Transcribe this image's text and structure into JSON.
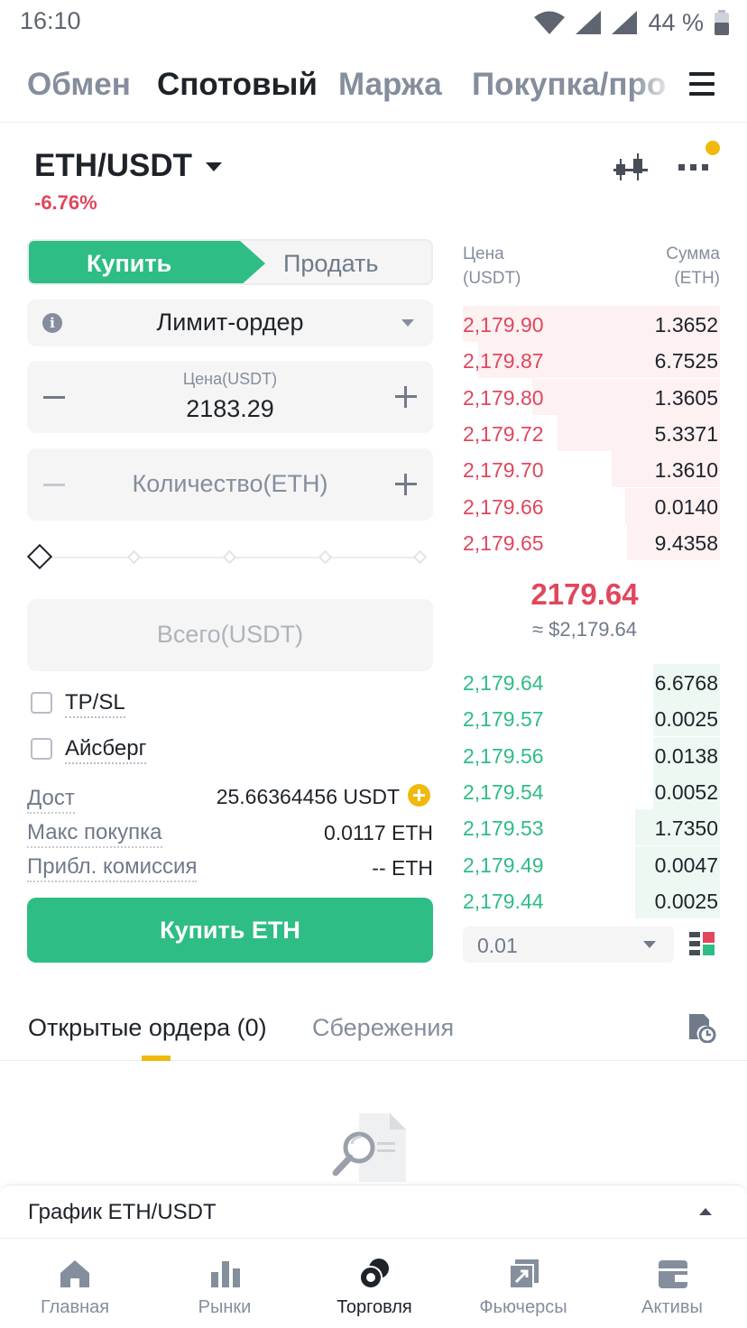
{
  "status_bar": {
    "time": "16:10",
    "battery": "44 %"
  },
  "top_tabs": [
    "Обмен",
    "Спотовый",
    "Маржа",
    "Покупка/про"
  ],
  "pair": {
    "name": "ETH/USDT",
    "change": "-6.76%"
  },
  "trade": {
    "buy_label": "Купить",
    "sell_label": "Продать",
    "order_type": "Лимит-ордер",
    "price_label": "Цена(USDT)",
    "price_value": "2183.29",
    "qty_placeholder": "Количество(ETH)",
    "total_placeholder": "Всего(USDT)",
    "tpsl_label": "TP/SL",
    "iceberg_label": "Айсберг",
    "avail_label": "Дост",
    "avail_value": "25.66364456 USDT",
    "max_label": "Макс покупка",
    "max_value": "0.0117 ETH",
    "fee_label": "Прибл. комиссия",
    "fee_value": "-- ETH",
    "buy_button": "Купить ETH",
    "slider_percent": 0
  },
  "orderbook": {
    "price_header": "Цена",
    "price_unit": "(USDT)",
    "amount_header": "Сумма",
    "amount_unit": "(ETH)",
    "asks": [
      {
        "price": "2,179.90",
        "amount": "1.3652",
        "depth": 1.0
      },
      {
        "price": "2,179.87",
        "amount": "6.7525",
        "depth": 0.94
      },
      {
        "price": "2,179.80",
        "amount": "1.3605",
        "depth": 0.73
      },
      {
        "price": "2,179.72",
        "amount": "5.3371",
        "depth": 0.63
      },
      {
        "price": "2,179.70",
        "amount": "1.3610",
        "depth": 0.42
      },
      {
        "price": "2,179.66",
        "amount": "0.0140",
        "depth": 0.37
      },
      {
        "price": "2,179.65",
        "amount": "9.4358",
        "depth": 0.36
      }
    ],
    "last_price": "2179.64",
    "last_price_usd": "≈ $2,179.64",
    "bids": [
      {
        "price": "2,179.64",
        "amount": "6.6768",
        "depth": 0.26
      },
      {
        "price": "2,179.57",
        "amount": "0.0025",
        "depth": 0.26
      },
      {
        "price": "2,179.56",
        "amount": "0.0138",
        "depth": 0.26
      },
      {
        "price": "2,179.54",
        "amount": "0.0052",
        "depth": 0.26
      },
      {
        "price": "2,179.53",
        "amount": "1.7350",
        "depth": 0.33
      },
      {
        "price": "2,179.49",
        "amount": "0.0047",
        "depth": 0.33
      },
      {
        "price": "2,179.44",
        "amount": "0.0025",
        "depth": 0.33
      }
    ],
    "precision": "0.01"
  },
  "orders_tabs": {
    "open": "Открытые ордера (0)",
    "savings": "Сбережения"
  },
  "chart_bar": {
    "label": "График ETH/USDT"
  },
  "nav": [
    {
      "label": "Главная",
      "icon": "home-icon"
    },
    {
      "label": "Рынки",
      "icon": "markets-icon"
    },
    {
      "label": "Торговля",
      "icon": "trade-icon"
    },
    {
      "label": "Фьючерсы",
      "icon": "futures-icon"
    },
    {
      "label": "Активы",
      "icon": "wallet-icon"
    }
  ],
  "colors": {
    "buy": "#2ebd85",
    "sell": "#e0475d",
    "accent": "#f0b90b"
  }
}
